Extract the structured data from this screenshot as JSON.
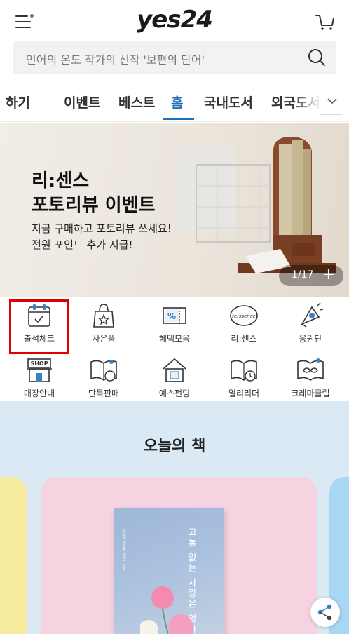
{
  "header": {
    "logo": "yes24"
  },
  "search": {
    "placeholder": "언어의 온도 작가의 신작 '보편의 단어'"
  },
  "tabs": [
    {
      "label": "하기"
    },
    {
      "label": "이벤트"
    },
    {
      "label": "베스트"
    },
    {
      "label": "홈",
      "active": true
    },
    {
      "label": "국내도서"
    },
    {
      "label": "외국도서"
    }
  ],
  "banner": {
    "title_line1": "리:센스",
    "title_line2": "포토리뷰 이벤트",
    "subtitle_line1": "지금 구매하고 포토리뷰 쓰세요!",
    "subtitle_line2": "전원 포인트 추가 지급!",
    "pager": "1/17",
    "pager_plus": "+"
  },
  "shortcuts": [
    {
      "label": "출석체크",
      "icon": "calendar-check-icon"
    },
    {
      "label": "사은품",
      "icon": "gift-bag-icon"
    },
    {
      "label": "혜택모음",
      "icon": "coupon-icon"
    },
    {
      "label": "리:센스",
      "icon": "ressence-icon",
      "icon_text": "re:ssence"
    },
    {
      "label": "응원단",
      "icon": "cheer-icon"
    },
    {
      "label": "매장안내",
      "icon": "shop-icon",
      "icon_text": "SHOP"
    },
    {
      "label": "단독판매",
      "icon": "exclusive-book-icon"
    },
    {
      "label": "예스펀딩",
      "icon": "funding-icon"
    },
    {
      "label": "얼리리더",
      "icon": "early-reader-icon"
    },
    {
      "label": "크레마클럽",
      "icon": "crema-club-icon"
    }
  ],
  "today": {
    "heading": "오늘의 책",
    "book_title": "고통 없는 사랑은 없다",
    "book_small": "당신의 세상을 바꾸는 사랑"
  },
  "colors": {
    "accent": "#1f6fb2",
    "highlight_border": "#e00000",
    "section_bg": "#dbe9f5",
    "card_pink": "#f6d3e1",
    "card_yellow": "#f6eb9c",
    "card_blue": "#a9d6f2"
  }
}
